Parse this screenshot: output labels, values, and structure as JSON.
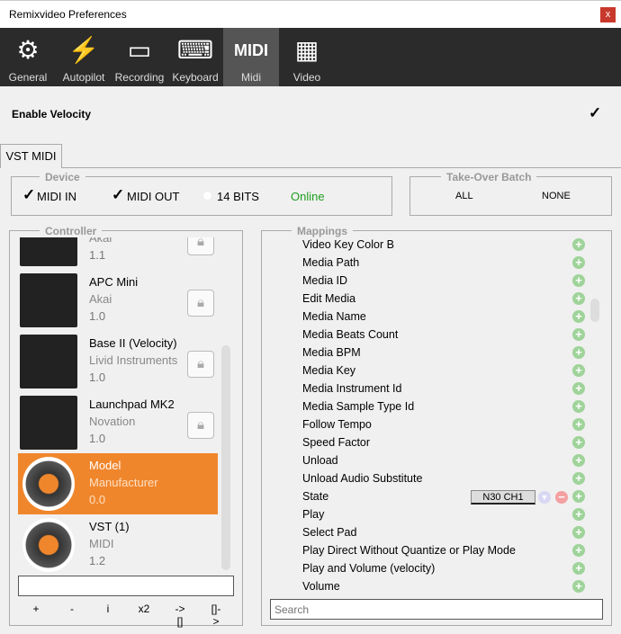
{
  "window": {
    "title": "Remixvideo Preferences",
    "close": "x"
  },
  "toolbar": {
    "tabs": [
      {
        "label": "General",
        "icon": "gears-icon",
        "glyph": "⚙"
      },
      {
        "label": "Autopilot",
        "icon": "lightning-icon",
        "glyph": "⚡"
      },
      {
        "label": "Recording",
        "icon": "cassette-icon",
        "glyph": "▭"
      },
      {
        "label": "Keyboard",
        "icon": "keyboard-icon",
        "glyph": "⌨"
      },
      {
        "label": "Midi",
        "icon": "general-midi-icon",
        "glyph": "MIDI",
        "selected": true
      },
      {
        "label": "Video",
        "icon": "film-icon",
        "glyph": "▦"
      }
    ]
  },
  "velocity": {
    "label": "Enable Velocity",
    "checked": true,
    "check": "✓"
  },
  "subtab": "VST MIDI",
  "device": {
    "legend": "Device",
    "midi_in": "MIDI IN",
    "midi_out": "MIDI OUT",
    "bits": "14 BITS",
    "status": "Online",
    "status_color": "#1e9e1e"
  },
  "takeover": {
    "legend": "Take-Over Batch",
    "all": "ALL",
    "none": "NONE"
  },
  "controller": {
    "legend": "Controller",
    "items": [
      {
        "name": "",
        "manufacturer": "Akai",
        "version": "1.1",
        "locked": true
      },
      {
        "name": "APC Mini",
        "manufacturer": "Akai",
        "version": "1.0",
        "locked": true
      },
      {
        "name": "Base II (Velocity)",
        "manufacturer": "Livid Instruments",
        "version": "1.0",
        "locked": true
      },
      {
        "name": "Launchpad MK2",
        "manufacturer": "Novation",
        "version": "1.0",
        "locked": true
      },
      {
        "name": "Model",
        "manufacturer": "Manufacturer",
        "version": "0.0",
        "selected": true
      },
      {
        "name": "VST (1)",
        "manufacturer": "MIDI",
        "version": "1.2"
      }
    ],
    "input_value": "",
    "buttons": [
      "+",
      "-",
      "i",
      "x2",
      "->[]",
      "[]->"
    ]
  },
  "mappings": {
    "legend": "Mappings",
    "items": [
      "Video Key Color B",
      "Media Path",
      "Media ID",
      "Edit Media",
      "Media Name",
      "Media Beats Count",
      "Media BPM",
      "Media Key",
      "Media Instrument Id",
      "Media Sample Type Id",
      "Follow Tempo",
      "Speed Factor",
      "Unload",
      "Unload Audio Substitute",
      "State",
      "Play",
      "Select Pad",
      "Play Direct Without Quantize or Play Mode",
      "Play and Volume (velocity)",
      "Volume"
    ],
    "state_binding": "N30 CH1",
    "search_placeholder": "Search"
  },
  "colors": {
    "accent": "#f0862c",
    "toolbar": "#2b2b2b"
  }
}
